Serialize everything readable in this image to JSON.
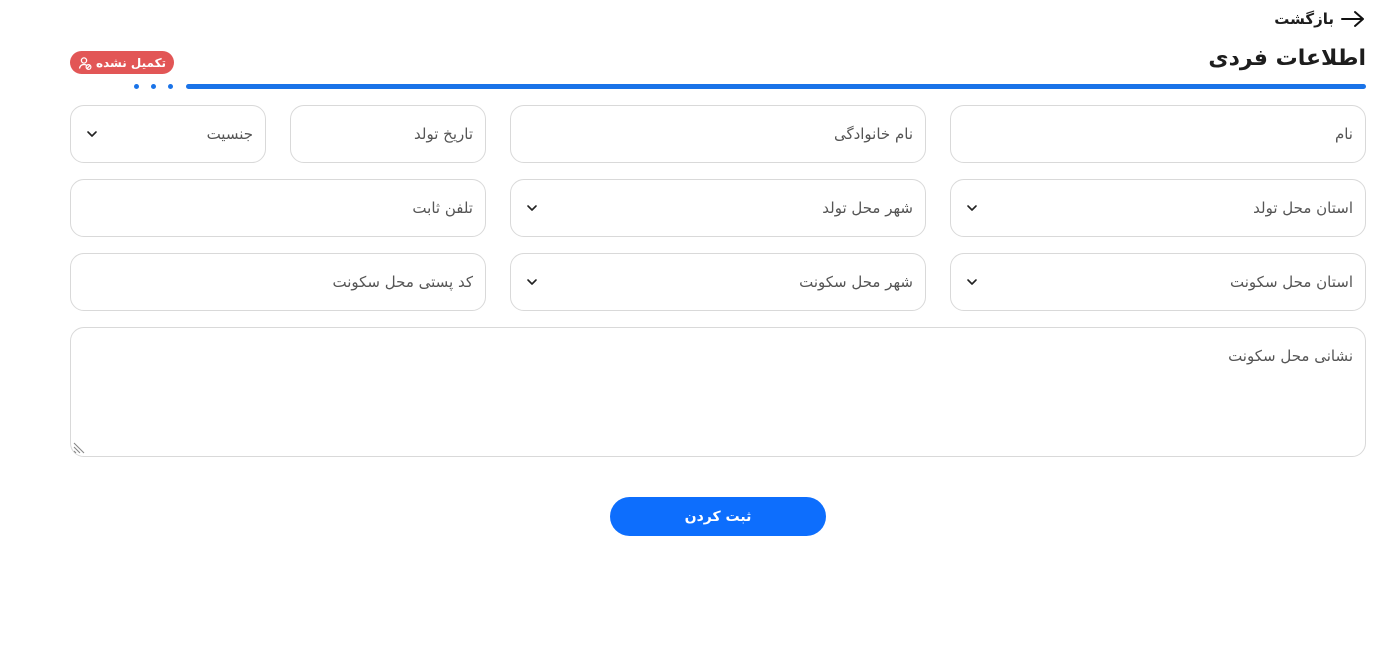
{
  "header": {
    "back_label": "بازگشت",
    "title": "اطلاعات فردی",
    "status_badge": "تکمیل نشده"
  },
  "form": {
    "first_name": "نام",
    "last_name": "نام خانوادگی",
    "birth_date": "تاریخ تولد",
    "gender": "جنسیت",
    "birth_province": "استان محل تولد",
    "birth_city": "شهر محل تولد",
    "landline": "تلفن ثابت",
    "residence_province": "استان محل سکونت",
    "residence_city": "شهر محل سکونت",
    "postal_code": "کد پستی محل سکونت",
    "address": "نشانی محل سکونت"
  },
  "actions": {
    "submit_label": "ثبت کردن"
  },
  "colors": {
    "accent": "#0d6efd",
    "progress": "#1a73e8",
    "badge": "#e25656"
  },
  "icons": {
    "back": "arrow-right-icon",
    "badge": "user-off-icon",
    "dropdown": "chevron-down-icon"
  }
}
